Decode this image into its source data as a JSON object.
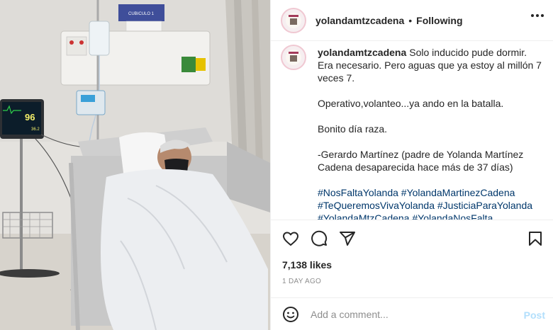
{
  "photo": {
    "room_sign": "CUBICULO 1",
    "monitor_value": "96",
    "monitor_value_small": "36.2"
  },
  "header": {
    "username": "yolandamtzcadena",
    "separator": "•",
    "follow_status": "Following"
  },
  "caption": {
    "username": "yolandamtzcadena",
    "paragraphs": [
      "Solo inducido pude dormir. Era necesario. Pero aguas que ya estoy al millón 7 veces 7.",
      "Operativo,volanteo...ya ando en la batalla.",
      "Bonito día raza.",
      "-Gerardo Martínez (padre de Yolanda Martínez Cadena desaparecida hace más de 37 días)"
    ],
    "hashtags": "#NosFaltaYolanda #YolandaMartinezCadena #TeQueremosVivaYolanda #JusticiaParaYolanda #YolandaMtzCadena #YolandaNosFalta"
  },
  "actions": {
    "like_icon": "heart-icon",
    "comment_icon": "comment-icon",
    "share_icon": "share-icon",
    "save_icon": "bookmark-icon"
  },
  "likes": "7,138 likes",
  "timestamp": "1 DAY AGO",
  "comment": {
    "placeholder": "Add a comment...",
    "post_label": "Post"
  }
}
